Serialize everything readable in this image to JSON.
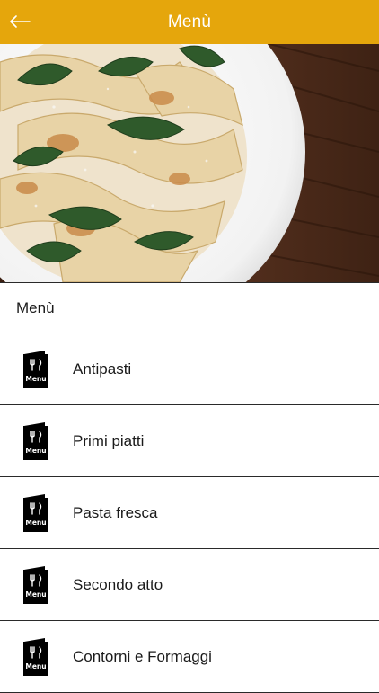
{
  "app_bar": {
    "title": "Menù",
    "back_icon": "arrow-left-icon",
    "background": "#E5A60C"
  },
  "hero": {
    "image": "pasta-dish-photo"
  },
  "section": {
    "title": "Menù"
  },
  "menu": {
    "icon": "menu-card-icon",
    "icon_text": "Menu",
    "items": [
      {
        "label": "Antipasti"
      },
      {
        "label": "Primi piatti"
      },
      {
        "label": "Pasta fresca"
      },
      {
        "label": "Secondo atto"
      },
      {
        "label": "Contorni e Formaggi"
      }
    ]
  }
}
